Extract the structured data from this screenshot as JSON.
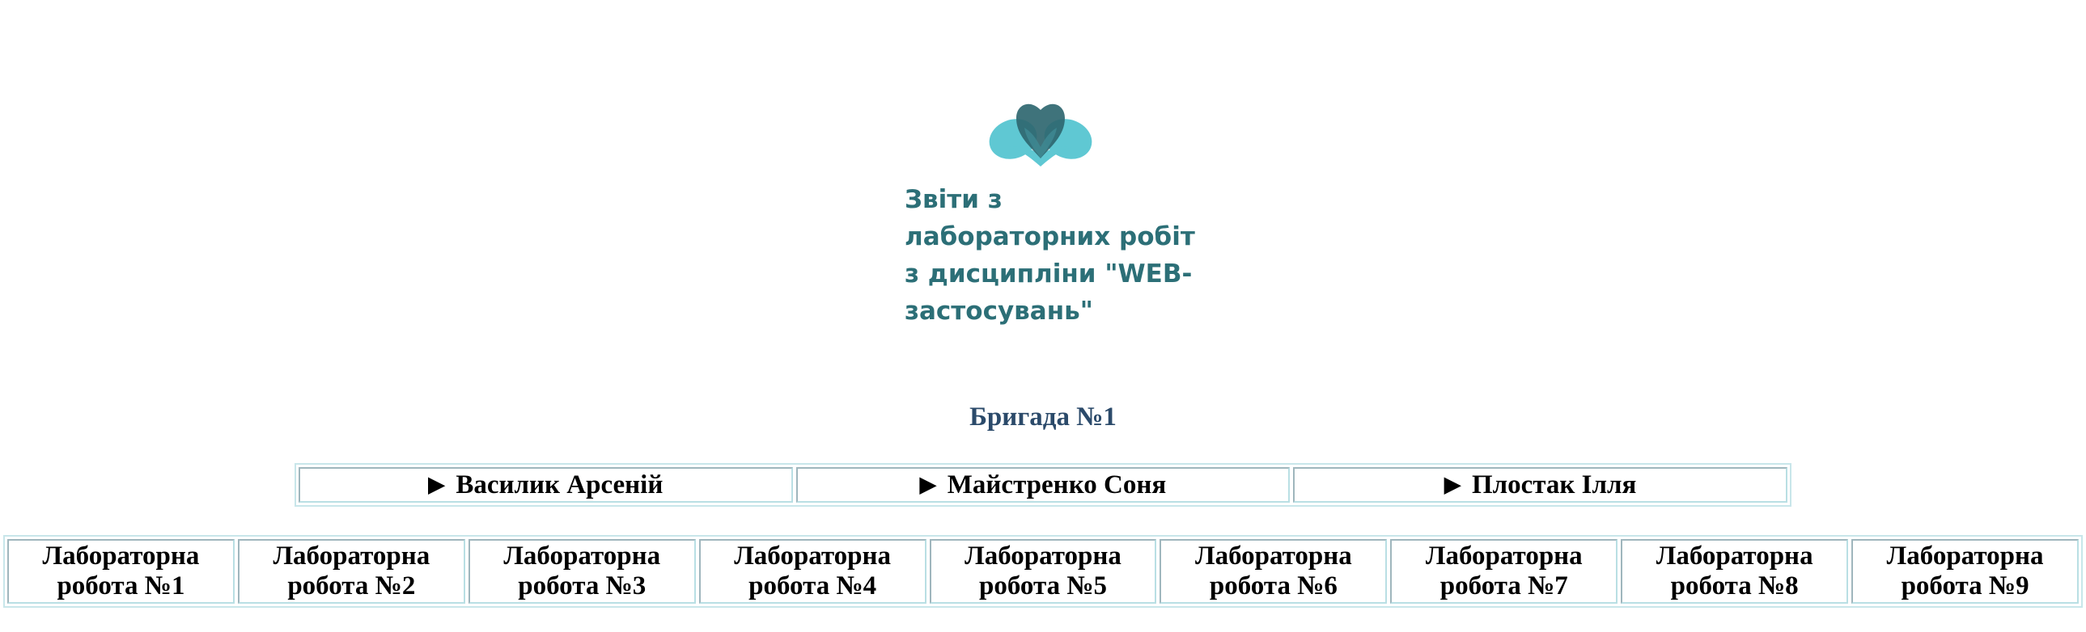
{
  "header": {
    "logo_icon": "two-hearts-logo-icon",
    "title_lines": [
      "Звіти з",
      "лабораторних робіт",
      "з дисципліни \"WEB-",
      "застосувань\""
    ]
  },
  "team": {
    "heading": "Бригада №1",
    "members": [
      {
        "label": "Василик Арсеній"
      },
      {
        "label": "Майстренко Соня"
      },
      {
        "label": "Плостак Ілля"
      }
    ],
    "expand_icon": "▶"
  },
  "labs": [
    {
      "line1": "Лабораторна",
      "line2": "робота №1"
    },
    {
      "line1": "Лабораторна",
      "line2": "робота №2"
    },
    {
      "line1": "Лабораторна",
      "line2": "робота №3"
    },
    {
      "line1": "Лабораторна",
      "line2": "робота №4"
    },
    {
      "line1": "Лабораторна",
      "line2": "робота №5"
    },
    {
      "line1": "Лабораторна",
      "line2": "робота №6"
    },
    {
      "line1": "Лабораторна",
      "line2": "робота №7"
    },
    {
      "line1": "Лабораторна",
      "line2": "робота №8"
    },
    {
      "line1": "Лабораторна",
      "line2": "робота №9"
    }
  ],
  "colors": {
    "title": "#2c6f77",
    "heading": "#2b4a6a",
    "logo_light": "#5fc8d3",
    "logo_dark": "#2f6770",
    "border": "#c8e6ea"
  }
}
